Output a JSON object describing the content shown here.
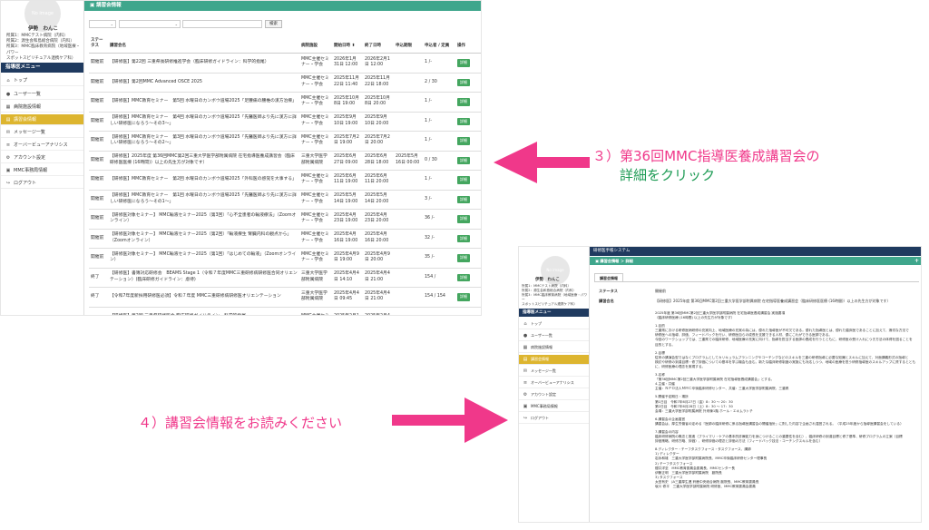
{
  "screen1": {
    "no_image": "No image",
    "user_name": "伊勢　わんこ",
    "roles": [
      "所属1：MMCテスト病院（内科）",
      "所属2：源生会和島総合病院（内科）",
      "所属3：MMC臨床教育病院（地域医療・パワー",
      "スポットスピリチュアル連携ケア科）"
    ],
    "menu_header": "指導医メニュー",
    "menu": [
      {
        "label": "トップ",
        "icon": "home-icon",
        "glyph": "⌂",
        "active": false
      },
      {
        "label": "ユーザー一覧",
        "icon": "user-icon",
        "glyph": "●",
        "active": false
      },
      {
        "label": "病院施設情報",
        "icon": "building-icon",
        "glyph": "▦",
        "active": false
      },
      {
        "label": "講習会情報",
        "icon": "book-icon",
        "glyph": "▤",
        "active": true
      },
      {
        "label": "メッセージ一覧",
        "icon": "envelope-icon",
        "glyph": "✉",
        "active": false
      },
      {
        "label": "オーバービューアナリシス",
        "icon": "chart-icon",
        "glyph": "≡",
        "active": false
      },
      {
        "label": "アカウント設定",
        "icon": "gear-icon",
        "glyph": "⚙",
        "active": false
      },
      {
        "label": "MMC事務局情報",
        "icon": "info-icon",
        "glyph": "▣",
        "active": false
      },
      {
        "label": "ログアウト",
        "icon": "logout-icon",
        "glyph": "↪",
        "active": false
      }
    ],
    "topbar": "講習会情報",
    "search_button": "検索",
    "headers": [
      "ステータス",
      "講習会名",
      "病院施設",
      "開始日時 ⬍",
      "終了日時",
      "申込期限",
      "申込者 / 定員",
      "操作"
    ],
    "detail_label": "詳細",
    "rows": [
      {
        "status": "開催前",
        "name": "【研修医】第22回 三重県後研修推進学会（臨床研修ガイドライン：科学的指尾）",
        "facility": "MMC主催セミナー・学会",
        "start": "2026年1月31日 12:00",
        "end": "2026年2月1日 12:00",
        "deadline": "",
        "count": "1 /-"
      },
      {
        "status": "開催前",
        "name": "【研修医】第2回MMC Advanced OSCE 2025",
        "facility": "MMC主催セミナー・学会",
        "start": "2025年11月22日 11:40",
        "end": "2025年11月22日 18:00",
        "deadline": "",
        "count": "2 / 30"
      },
      {
        "status": "開催前",
        "name": "【研修医】MMC教育セミナー　第5回 水曜日のカンボウ道場2025「足腰痛の腰椎の漢方治療」",
        "facility": "MMC主催セミナー・学会",
        "start": "2025年10月8日 19:00",
        "end": "2025年10月8日 20:00",
        "deadline": "",
        "count": "1 /-"
      },
      {
        "status": "開催前",
        "name": "【研修医】MMC教育セミナー　第4回 水曜日のカンボウ道場2025「先醫医師より先に漢方に詳しい研修医になろう〜その3〜」",
        "facility": "MMC主催セミナー・学会",
        "start": "2025年9月10日 19:00",
        "end": "2025年9月10日 20:00",
        "deadline": "",
        "count": "1 /-"
      },
      {
        "status": "開催前",
        "name": "【研修医】MMC教育セミナー　第3回 水曜日のカンボウ道場2025「先醫医師より先に漢方に詳しい研修医になろう〜その2〜」",
        "facility": "MMC主催セミナー・学会",
        "start": "2025年7月2日 19:00",
        "end": "2025年7月2日 20:00",
        "deadline": "",
        "count": "1 /-"
      },
      {
        "status": "開催前",
        "name": "【研修医】2025年度 第36回MMC第2回三重大学医学部附属病院 在宅指導医養成講習会（臨床研修医医療 (16時間)）以上の先生方が対象です）",
        "facility": "三重大学医学部附属病院",
        "start": "2025年6月27日 09:00",
        "end": "2025年6月28日 18:00",
        "deadline": "2025年5月16日 00:00",
        "count": "0 / 30"
      },
      {
        "status": "開催前",
        "name": "【研修医】MMC教育セミナー　第2回 水曜日のカンボウ道場2025「外科医の感覚を大事する」",
        "facility": "MMC主催セミナー・学会",
        "start": "2025年6月11日 19:00",
        "end": "2025年6月11日 20:00",
        "deadline": "",
        "count": "1 /-"
      },
      {
        "status": "開催前",
        "name": "【研修医】MMC教育セミナー　第1回 水曜日のカンボウ道場2025「先醫医師より先に漢方に詳しい研修医になろう〜その1〜」",
        "facility": "MMC主催セミナー・学会",
        "start": "2025年5月14日 19:00",
        "end": "2025年5月14日 20:00",
        "deadline": "",
        "count": "3 /-"
      },
      {
        "status": "開催前",
        "name": "【研修医対象セミナー】 MMC輸液セミナー2025（第3回）「心不全患者の輸液療法」（Zoomオンライン）",
        "facility": "MMC主催セミナー・学会",
        "start": "2025年4月23日 19:00",
        "end": "2025年4月23日 20:00",
        "deadline": "",
        "count": "36 /-"
      },
      {
        "status": "開催前",
        "name": "【研修医対象セミナー】 MMC輸液セミナー2025（第2回）「輸液療生 腎臓内科の観点から」（Zoomオンライン）",
        "facility": "MMC主催セミナー・学会",
        "start": "2025年4月16日 19:00",
        "end": "2025年4月16日 20:00",
        "deadline": "",
        "count": "32 /-"
      },
      {
        "status": "開催前",
        "name": "【研修医対象セミナー】 MMC輸液セミナー2025（第1回）「はじめての輸液」（Zoomオンライン）",
        "facility": "MMC主催セミナー・学会",
        "start": "2025年4月9日 19:00",
        "end": "2025年4月9日 20:00",
        "deadline": "",
        "count": "35 /-"
      },
      {
        "status": "終了",
        "name": "【研修医】書簿対応研修会　BEAMS Stage 1（令和７年度MMC三重研修病研修医合同オリエンテーション）(臨床研修ガイドライン：虐待)",
        "facility": "三重大学医学部附属病院",
        "start": "2025年4月4日 14:10",
        "end": "2025年4月4日 21:00",
        "deadline": "",
        "count": "154 /"
      },
      {
        "status": "終了",
        "name": "【令和7年度新採用研修医必須】令和７年度 MMC三重研修病研修医オリエンテーション",
        "facility": "三重大学医学部附属病院",
        "start": "2025年4月4日 09:45",
        "end": "2025年4月4日 21:00",
        "deadline": "",
        "count": "154 / 154"
      },
      {
        "status": "",
        "name": "【研修医】第2回 三重県研修医会 臨床研修ガイドライン・科学的指尾",
        "facility": "MMC主催セミ",
        "start": "2025年2月1",
        "end": "2025年2月4",
        "deadline": "",
        "count": ""
      }
    ]
  },
  "screen2": {
    "header": "研修医手帳システム",
    "breadcrumb": "講習会情報 ＞ 詳細",
    "no_image": "No image",
    "user_name": "伊勢　わんこ",
    "roles": [
      "所属1：MMCテスト病院（内科）",
      "所属2：源生会和島総合病院（内科）",
      "所属3：MMC臨床教育病院（地域医療・パワー",
      "スポットスピリチュアル連携ケア科）"
    ],
    "menu_header": "指導医メニュー",
    "tab": "講習会情報",
    "status_label": "ステータス",
    "status_value": "開催前",
    "name_label": "講習会名",
    "name_value": "【研修医】2025年度 第36回MMC第2回三重大学医学部附属病院 在宅指導医養成講習会（臨床研修医医療 (16時間)）以上の先生方が対象です）",
    "body": [
      "2025年度 第36回MMC第2回三重大学医学部附属病院 在宅指導医養成講習会 実施要項",
      "（臨床研修医療 (16時間) 以上の先生方が対象です）",
      "",
      "1.目的",
      "三重県における研修医病研修の充実向上、地域医療の充実の為には、優れた指導医が不可欠である。優れた指導医とは、優れた臨床医であることに加えて、適切な方法で",
      "研修医への指導、評価、フィードバックを行い、研修医自らの成長を支援できる人材、優にこれができる医師である。",
      "今回のワークショップでは、三重県での臨床研修、地域医療の充実に向けて、指導を担当する医師の養成を行うとともに、研修医の受け入れにつき方法の体得を図ることを",
      "目的とする。",
      "",
      "2.目標",
      "従来の講演会型ではなくプログラムとしてカリキュラムプランニングやコーチングなどのスキルを三重の研修指導に必要な知識とスキルに加えて、対面講義形式の指導と",
      "検討や研修の到達目標・修了評価についての基本を学ぶ機会も含む。新たな臨床研修制度の実施にも対応しつつ、地域の医療を担う研修指導医のスキルアップに資するととも",
      "に、研修医療の理念を実現する。",
      "",
      "3.名称",
      "「第36回MMC第2回三重大学医学部附属病院 在宅指導医養成講習会」とする。",
      "4.主催・共催",
      "主催：ＮＰＯ法人ＭＭＣ卒後臨床研修センター、共催：三重大学医学部附属病院、三重県",
      "",
      "5.開催予定期日・場所",
      "第1日目　令和7年6月27日（金）8：30 〜 20：30",
      "第2日目　令和7年6月28日（土）8：30 〜 17：30",
      "会場：三重大学医学部附属病院 外来棟1階 ホール・エキムラトチ",
      "",
      "6.講習会の企画運営",
      "講習会は、厚生労働省の定める『医師の臨床研修に係る指導医講習会の開催指針』に則した内容で企画され運営される。（平成25年度から指導医講習会をしている）",
      "",
      "7.講習会の内容",
      "臨床研修病院の概念と推進（プライマリ・ケアの基本的診療能力を身につけることの重要性を含む）、臨床研修の到達目標と修了基準、研修プログラムの立案（目標",
      "評価策略、研修方略、評価）、研修評価の理念と評価の方法（フィードバック技法・コーチングスキルを含む）",
      "",
      "8.ディレクター・チーフタスクフォース・タスクフォース、講師",
      "1) ディレクター",
      "岩永和雄　三重大学医学部附属病院長、MMC卒後臨床研修センター理事長",
      "2) チーフタスクフォース",
      "櫻井洋至　MMC教育委員会委員長、MMCセンター長",
      "伊藤正明　三重大学医学部附属病院　副院長",
      "3) タスクフォース",
      "太田有史　JA三重厚生連 鈴鹿中央総合病院 副院長、MMC教育委員長",
      "坂川 修平　三重大学医学部附属病院 研修医、MMC教育委員会委員"
    ]
  },
  "annotations": {
    "step3_line1": "３）第36回MMC指導医養成講習会の",
    "step3_line2": "詳細をクリック",
    "step4": "４）講習会情報をお読みください"
  },
  "colors": {
    "navy": "#1f3a5f",
    "teal": "#3fa68c",
    "gold": "#ddb52f",
    "pink": "#f0388a",
    "green": "#1e9b55"
  }
}
